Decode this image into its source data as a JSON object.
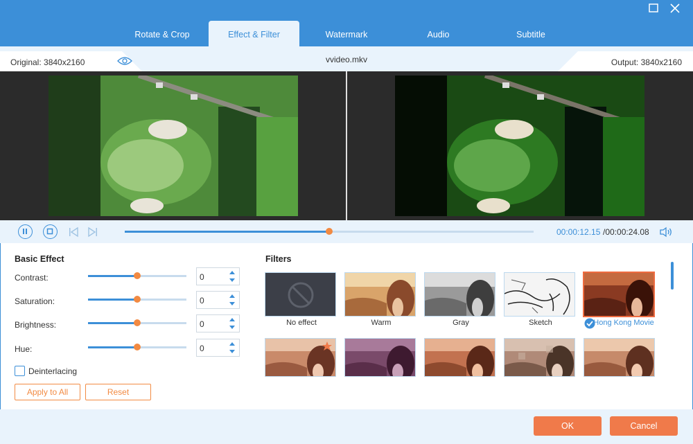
{
  "tabs": [
    "Rotate & Crop",
    "Effect & Filter",
    "Watermark",
    "Audio",
    "Subtitle"
  ],
  "active_tab": "Effect & Filter",
  "info": {
    "original": "Original: 3840x2160",
    "filename": "vvideo.mkv",
    "output": "Output: 3840x2160"
  },
  "playback": {
    "current_time": "00:00:12.15",
    "total_time": "/00:00:24.08",
    "progress": 0.5
  },
  "basic_effect": {
    "title": "Basic Effect",
    "items": [
      {
        "label": "Contrast:",
        "value": "0",
        "level": 0.5
      },
      {
        "label": "Saturation:",
        "value": "0",
        "level": 0.5
      },
      {
        "label": "Brightness:",
        "value": "0",
        "level": 0.5
      },
      {
        "label": "Hue:",
        "value": "0",
        "level": 0.5
      }
    ],
    "deinterlacing_label": "Deinterlacing",
    "apply_all_label": "Apply to All",
    "reset_label": "Reset"
  },
  "filters": {
    "title": "Filters",
    "row1": [
      {
        "name": "No effect"
      },
      {
        "name": "Warm"
      },
      {
        "name": "Gray"
      },
      {
        "name": "Sketch"
      },
      {
        "name": "Hong Kong Movie"
      }
    ],
    "selected": "Hong Kong Movie"
  },
  "footer": {
    "ok_label": "OK",
    "cancel_label": "Cancel"
  },
  "colors": {
    "accent": "#3c8fd8",
    "orange": "#f28a42",
    "button": "#f07a4a"
  }
}
